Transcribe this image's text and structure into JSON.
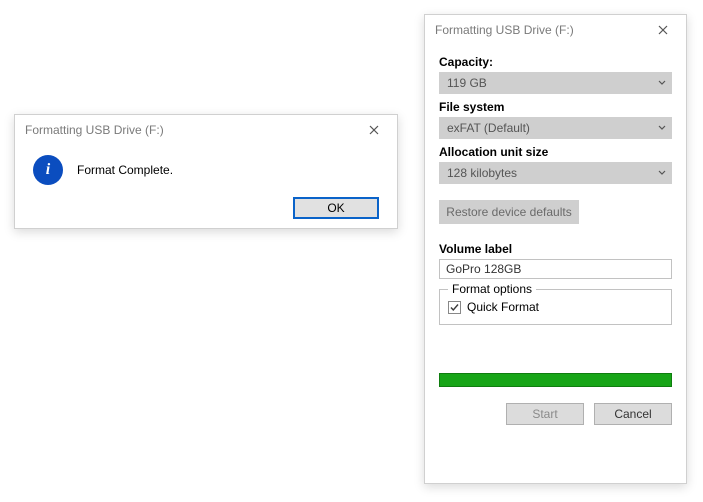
{
  "dialogA": {
    "title": "Formatting USB Drive (F:)",
    "icon": "info-icon",
    "message": "Format Complete.",
    "ok_label": "OK"
  },
  "dialogB": {
    "title": "Formatting USB Drive (F:)",
    "capacity": {
      "label": "Capacity:",
      "value": "119 GB"
    },
    "filesystem": {
      "label": "File system",
      "value": "exFAT (Default)"
    },
    "allocation": {
      "label": "Allocation unit size",
      "value": "128 kilobytes"
    },
    "restore_label": "Restore device defaults",
    "volume": {
      "label": "Volume label",
      "value": "GoPro 128GB"
    },
    "options": {
      "legend": "Format options",
      "quick_format_label": "Quick Format",
      "quick_format_checked": true
    },
    "progress_percent": 100,
    "start_label": "Start",
    "close_label": "Cancel"
  }
}
